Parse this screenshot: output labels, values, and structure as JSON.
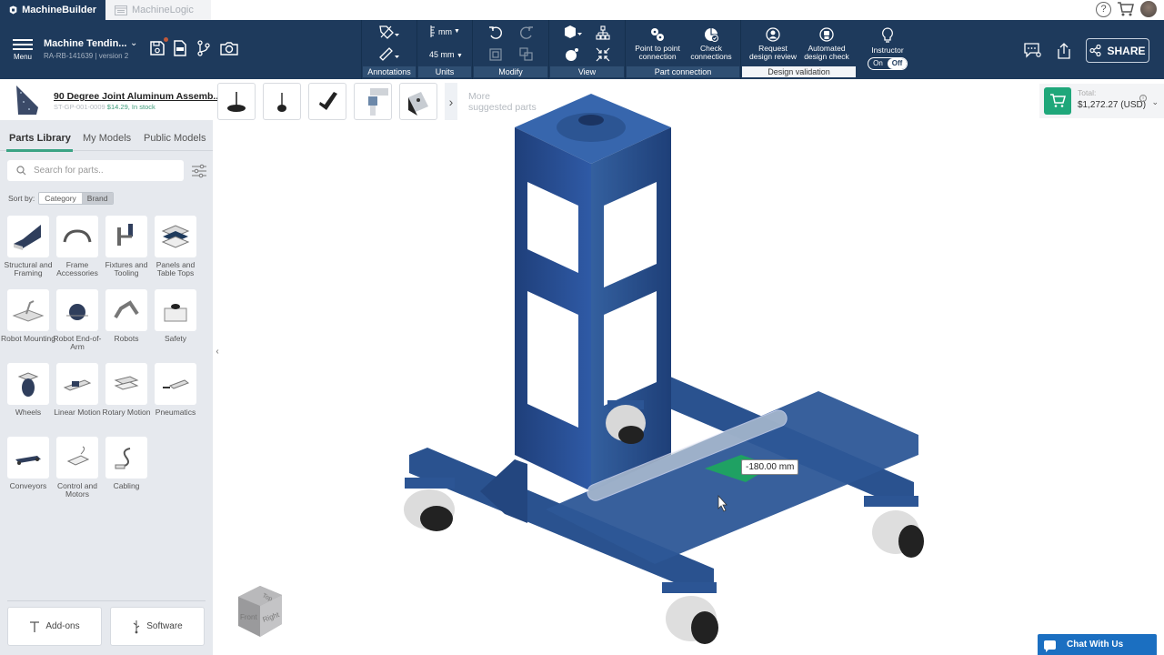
{
  "tabs": [
    {
      "label": "MachineBuilder",
      "active": true,
      "icon": "machinebuilder-logo-icon"
    },
    {
      "label": "MachineLogic",
      "active": false,
      "icon": "machinelogic-window-icon"
    }
  ],
  "top_right": {
    "help_icon": "help-icon",
    "cart_icon": "cart-icon",
    "avatar": "user-avatar"
  },
  "toolbar": {
    "menu_label": "Menu",
    "project_name": "Machine Tendin...",
    "project_sub": "RA-RB-141639 | version 2",
    "project_icons": [
      "save-icon",
      "bom-icon",
      "branch-icon",
      "camera-icon"
    ],
    "groups": {
      "annotations": {
        "label": "Annotations",
        "buttons": [
          "tag-icon",
          "ruler-icon"
        ]
      },
      "units": {
        "label": "Units",
        "unit": "mm",
        "grid": "45 mm"
      },
      "modify": {
        "label": "Modify",
        "buttons": [
          "undo-icon",
          "redo-icon",
          "group-icon",
          "ungroup-icon"
        ]
      },
      "view": {
        "label": "View",
        "buttons": [
          "cube-view-icon",
          "hierarchy-icon",
          "explode-icon",
          "collapse-icon"
        ]
      },
      "part_connection": {
        "label": "Part connection",
        "buttons": [
          {
            "label": "Point to point connection"
          },
          {
            "label": "Check connections"
          }
        ]
      },
      "design_validation": {
        "label": "Design validation",
        "buttons": [
          {
            "label": "Request design review"
          },
          {
            "label": "Automated design check"
          }
        ]
      }
    },
    "instructor": {
      "label": "Instructor",
      "on": "On",
      "off": "Off",
      "state": "Off"
    },
    "share_label": "SHARE"
  },
  "selected_part": {
    "title": "90 Degree Joint Aluminum Assemb...",
    "sku": "ST-GP-001-0009",
    "price": "$14.29",
    "stock": ", In stock"
  },
  "sidebar": {
    "tabs": [
      {
        "label": "Parts Library",
        "active": true
      },
      {
        "label": "My Models",
        "active": false
      },
      {
        "label": "Public Models",
        "active": false
      }
    ],
    "search_placeholder": "Search for parts..",
    "sort_label": "Sort by:",
    "sort_options": [
      "Category",
      "Brand"
    ],
    "sort_selected": "Category",
    "categories": [
      {
        "label": "Structural and Framing"
      },
      {
        "label": "Frame Accessories"
      },
      {
        "label": "Fixtures and Tooling"
      },
      {
        "label": "Panels and Table Tops"
      },
      {
        "label": "Robot Mounting"
      },
      {
        "label": "Robot End-of-Arm"
      },
      {
        "label": "Robots"
      },
      {
        "label": "Safety"
      },
      {
        "label": "Wheels"
      },
      {
        "label": "Linear Motion"
      },
      {
        "label": "Rotary Motion"
      },
      {
        "label": "Pneumatics"
      },
      {
        "label": "Conveyors"
      },
      {
        "label": "Control and Motors"
      },
      {
        "label": "Cabling"
      }
    ],
    "addons_label": "Add-ons",
    "software_label": "Software"
  },
  "suggested": {
    "items": [
      "leveling-foot-large",
      "leveling-foot-small",
      "handle-bracket",
      "corner-connector",
      "angle-bracket"
    ],
    "more_label_1": "More",
    "more_label_2": "suggested parts"
  },
  "cart": {
    "total_label": "Total:",
    "amount": "$1,272.27 (USD)"
  },
  "viewport": {
    "measurement": "-180.00 mm",
    "view_cube": {
      "top": "Top",
      "front": "Front",
      "right": "Right"
    }
  },
  "chat": {
    "label": "Chat With Us"
  }
}
